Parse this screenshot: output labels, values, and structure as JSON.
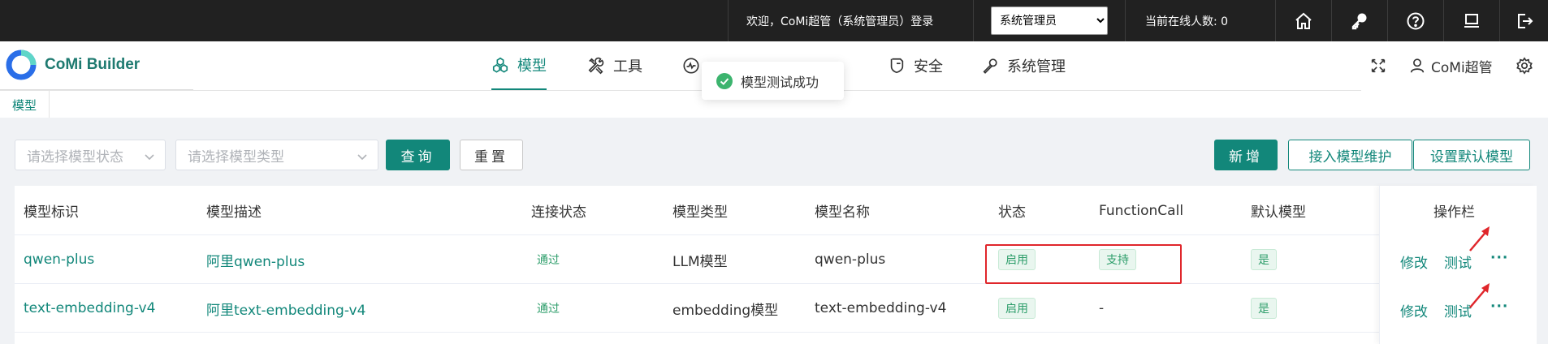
{
  "topbar": {
    "welcome": "欢迎，CoMi超管（系统管理员）登录",
    "role_selected": "系统管理员",
    "online": "当前在线人数: 0",
    "icons": [
      "home-icon",
      "key-icon",
      "help-icon",
      "monitor-icon",
      "logout-icon"
    ]
  },
  "header": {
    "app_name": "CoMi Builder",
    "nav": [
      {
        "label": "模型",
        "icon": "model-icon",
        "active": true
      },
      {
        "label": "工具",
        "icon": "tools-icon",
        "active": false
      },
      {
        "label": "",
        "icon": "monitor-wave-icon",
        "active": false
      },
      {
        "label": "安全",
        "icon": "shield-icon",
        "active": false
      },
      {
        "label": "系统管理",
        "icon": "wrench-icon",
        "active": false
      }
    ],
    "user_name": "CoMi超管"
  },
  "toast": {
    "text": "模型测试成功"
  },
  "tabs": [
    {
      "label": "模型"
    }
  ],
  "filters": {
    "status_placeholder": "请选择模型状态",
    "type_placeholder": "请选择模型类型",
    "query_label": "查询",
    "reset_label": "重置"
  },
  "actions": {
    "add_label": "新增",
    "access_label": "接入模型维护",
    "default_label": "设置默认模型"
  },
  "table": {
    "columns": [
      "模型标识",
      "模型描述",
      "连接状态",
      "模型类型",
      "模型名称",
      "状态",
      "FunctionCall",
      "默认模型",
      "操作栏"
    ],
    "rows": [
      {
        "id": "qwen-plus",
        "desc": "阿里qwen-plus",
        "conn": "通过",
        "type": "LLM模型",
        "name": "qwen-plus",
        "status": "启用",
        "fc": "支持",
        "default": "是",
        "edit": "修改",
        "test": "测试",
        "more": "···"
      },
      {
        "id": "text-embedding-v4",
        "desc": "阿里text-embedding-v4",
        "conn": "通过",
        "type": "embedding模型",
        "name": "text-embedding-v4",
        "status": "启用",
        "fc": "-",
        "default": "是",
        "edit": "修改",
        "test": "测试",
        "more": "···"
      }
    ]
  },
  "colors": {
    "accent": "#12877a",
    "topbar": "#212121",
    "annotation": "#e0262b",
    "success": "#2e9e6b"
  }
}
